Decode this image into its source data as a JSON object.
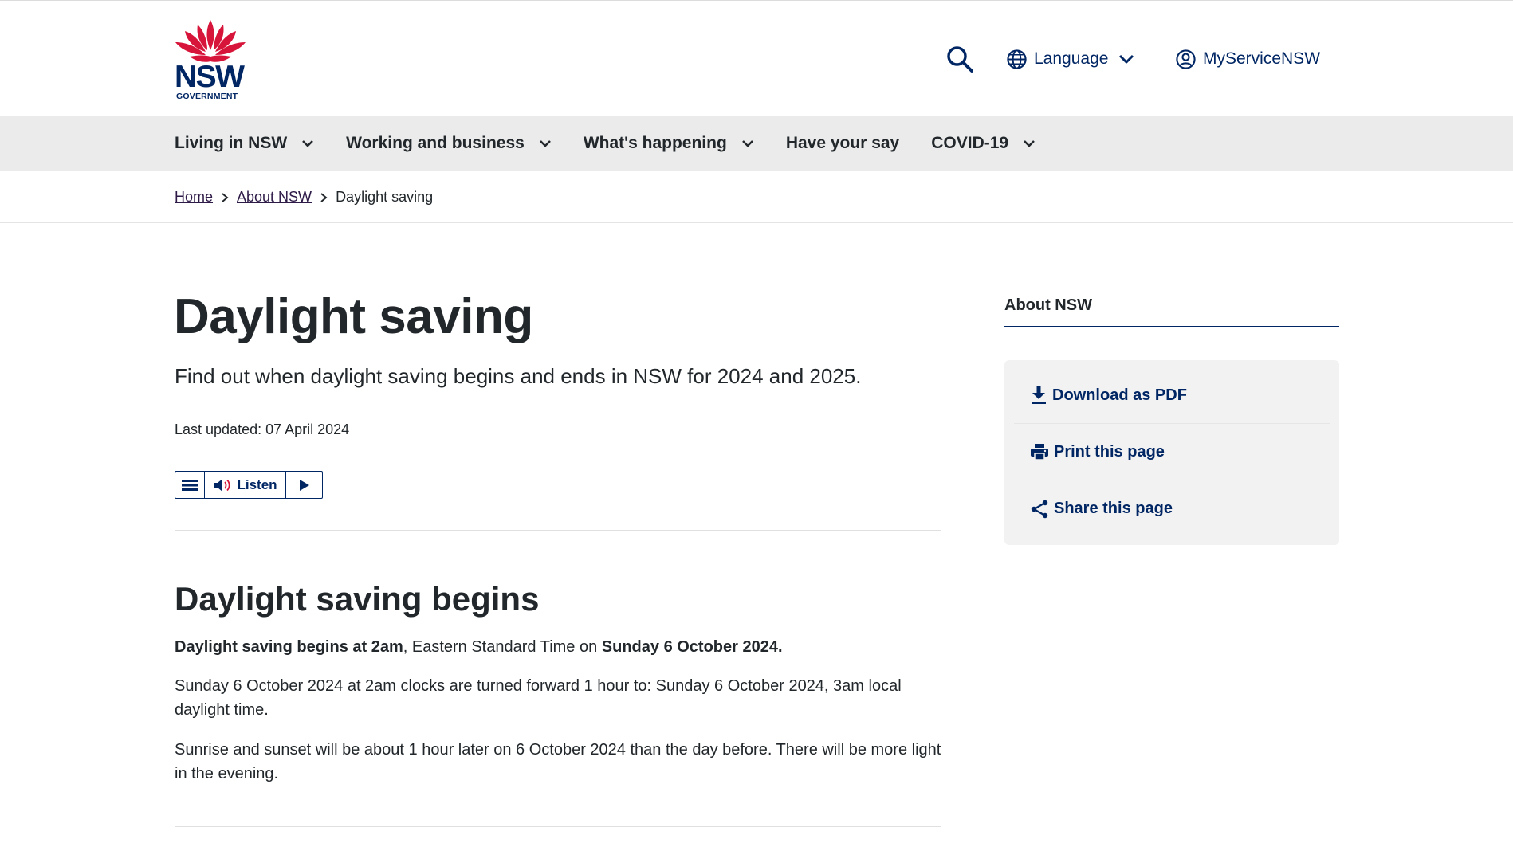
{
  "header": {
    "logo": {
      "wordmark": "NSW",
      "subword": "GOVERNMENT"
    },
    "utility": {
      "search_icon": "search-icon",
      "language_label": "Language",
      "account_label": "MyServiceNSW"
    }
  },
  "nav": {
    "items": [
      {
        "label": "Living in NSW",
        "has_dropdown": true
      },
      {
        "label": "Working and business",
        "has_dropdown": true
      },
      {
        "label": "What's happening",
        "has_dropdown": true
      },
      {
        "label": "Have your say",
        "has_dropdown": false
      },
      {
        "label": "COVID-19",
        "has_dropdown": true
      }
    ]
  },
  "breadcrumb": {
    "home": "Home",
    "about": "About NSW",
    "current": "Daylight saving"
  },
  "page": {
    "title": "Daylight saving",
    "intro": "Find out when daylight saving begins and ends in NSW for 2024 and 2025.",
    "updated": "Last updated: 07 April 2024",
    "listen_label": "Listen"
  },
  "section": {
    "title": "Daylight saving begins",
    "p1_bold_a": "Daylight saving begins at 2am",
    "p1_mid": ", Eastern Standard Time on ",
    "p1_bold_b": "Sunday 6 October 2024.",
    "p2": "Sunday 6 October 2024 at 2am clocks are turned forward 1 hour to: Sunday 6 October 2024, 3am local daylight time.",
    "p3": "Sunrise and sunset will be about 1 hour later on 6 October 2024 than the day before. There will be more light in the evening."
  },
  "sidebar": {
    "heading": "About NSW",
    "actions": [
      {
        "label": "Download as PDF",
        "icon": "download-icon"
      },
      {
        "label": "Print this page",
        "icon": "print-icon"
      },
      {
        "label": "Share this page",
        "icon": "share-icon"
      }
    ]
  },
  "colors": {
    "brand_navy": "#002664",
    "brand_red": "#d7153a",
    "nav_bg": "#ebebeb",
    "text": "#22272b"
  }
}
